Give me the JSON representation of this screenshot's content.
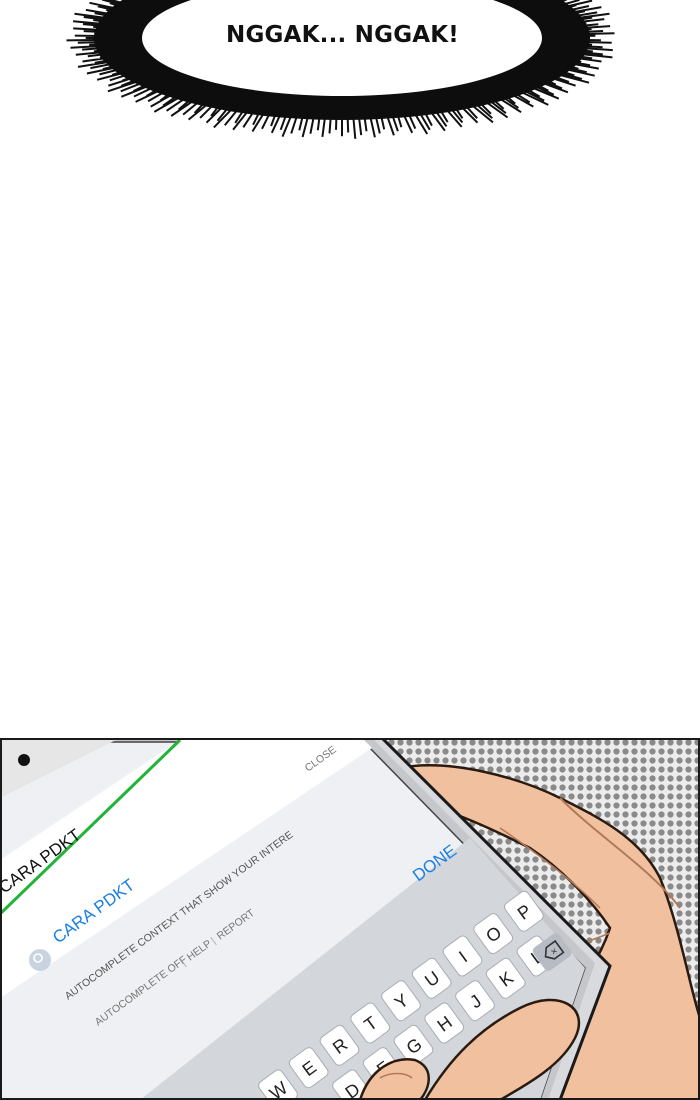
{
  "speech_bubble": {
    "text": "NGGAK... NGGAK!"
  },
  "phone": {
    "search_query": "CARA PDKT",
    "suggestion": "CARA PDKT",
    "notice_line": "AUTOCOMPLETE CONTEXT THAT SHOW YOUR INTERE",
    "close_label": "CLOSE",
    "autocomplete_off": "AUTOCOMPLETE OFF",
    "separator_1": "|",
    "help_label": "HELP",
    "separator_2": "|",
    "report_label": "REPORT",
    "done_label": "DONE",
    "keyboard_row1": [
      "W",
      "E",
      "R",
      "T",
      "Y",
      "U",
      "I",
      "O",
      "P"
    ],
    "keyboard_row2": [
      "D",
      "F",
      "G",
      "H",
      "J",
      "K",
      "L"
    ],
    "accent_color": "#1a7fe0",
    "border_green": "#22b33a"
  }
}
